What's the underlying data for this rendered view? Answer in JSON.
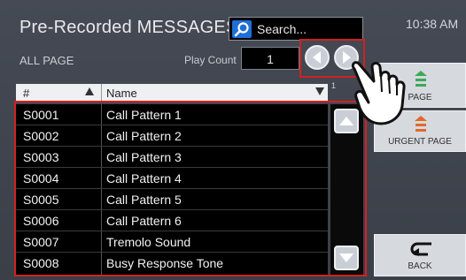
{
  "header": {
    "title": "Pre-Recorded MESSAGES",
    "search_placeholder": "Search...",
    "time": "10:38 AM"
  },
  "filters": {
    "scope_label": "ALL PAGE",
    "play_count_label": "Play Count",
    "play_count_value": "1"
  },
  "list": {
    "columns": [
      "#",
      "Name"
    ],
    "page_indicator": "1",
    "rows": [
      {
        "id": "S0001",
        "name": "Call Pattern 1"
      },
      {
        "id": "S0002",
        "name": "Call Pattern 2"
      },
      {
        "id": "S0003",
        "name": "Call Pattern 3"
      },
      {
        "id": "S0004",
        "name": "Call Pattern 4"
      },
      {
        "id": "S0005",
        "name": "Call Pattern 5"
      },
      {
        "id": "S0006",
        "name": "Call Pattern 6"
      },
      {
        "id": "S0007",
        "name": "Tremolo Sound"
      },
      {
        "id": "S0008",
        "name": "Busy Response Tone"
      }
    ]
  },
  "side_buttons": {
    "page": "PAGE",
    "urgent_page": "URGENT PAGE",
    "back": "BACK"
  },
  "colors": {
    "highlight_outline": "#d42020",
    "page_icon": "#3aaa5a",
    "urgent_icon": "#e06a2a",
    "search_icon_bg": "#1f6fd6"
  }
}
